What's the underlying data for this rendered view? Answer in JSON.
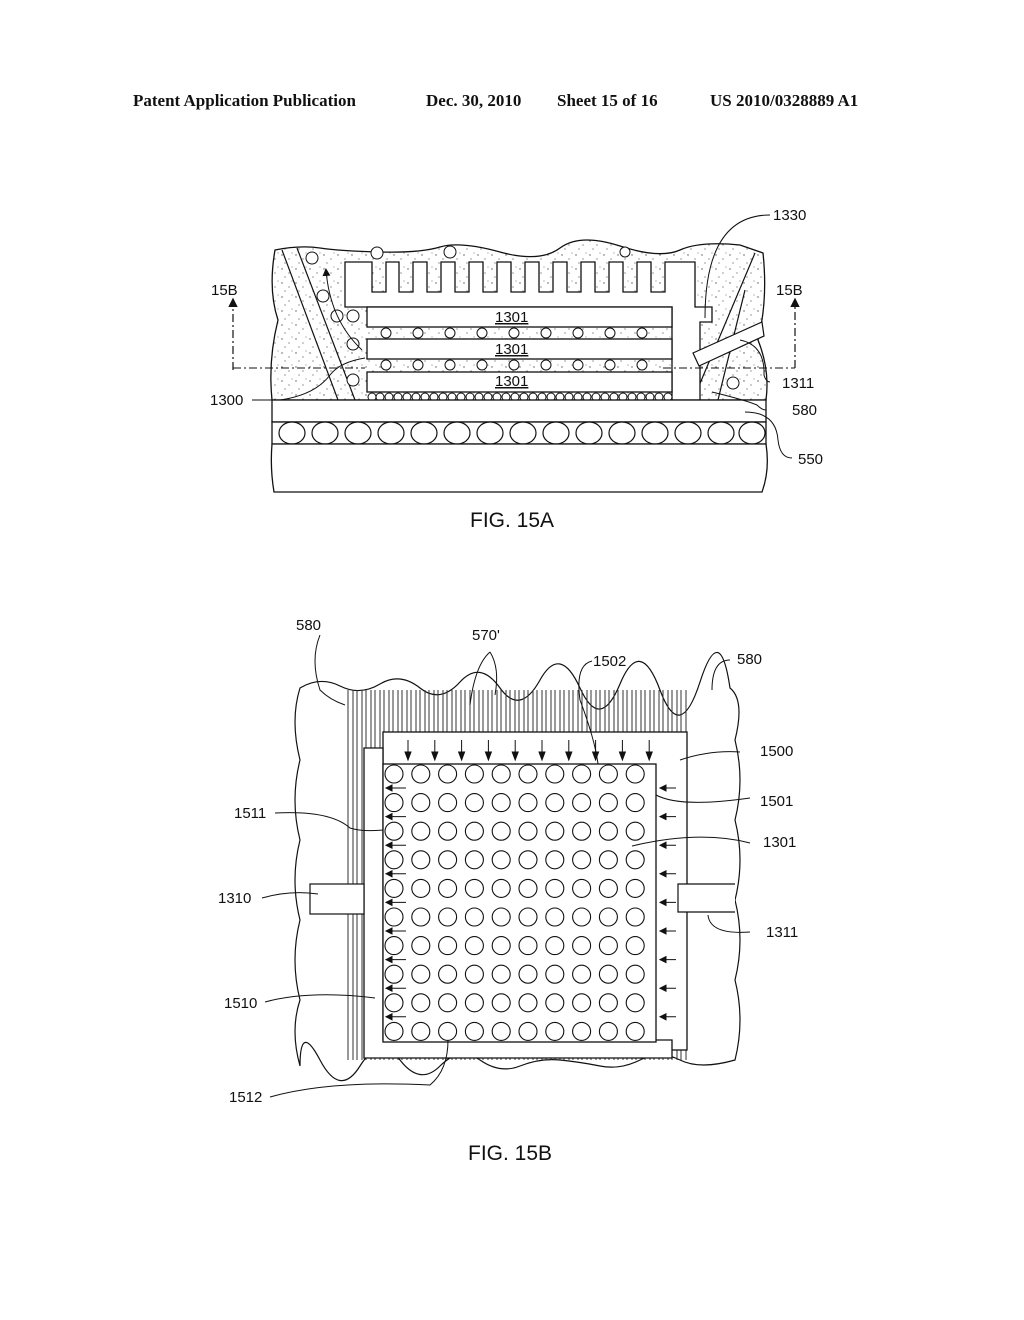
{
  "header": {
    "publication": "Patent Application Publication",
    "date": "Dec. 30, 2010",
    "sheet": "Sheet 15 of 16",
    "number": "US 2010/0328889 A1"
  },
  "fig15a": {
    "caption": "FIG. 15A",
    "section_left": "15B",
    "section_right": "15B",
    "die_labels": [
      "1301",
      "1301",
      "1301"
    ],
    "refs": {
      "r1330": "1330",
      "r1311": "1311",
      "r1300": "1300",
      "r580": "580",
      "r550": "550"
    }
  },
  "fig15b": {
    "caption": "FIG. 15B",
    "refs": {
      "r580_left": "580",
      "r570": "570'",
      "r1502": "1502",
      "r580_right": "580",
      "r1500": "1500",
      "r1501": "1501",
      "r1301": "1301",
      "r1511": "1511",
      "r1310": "1310",
      "r1311": "1311",
      "r1510": "1510",
      "r1512": "1512"
    },
    "grid": {
      "rows": 10,
      "cols": 10
    }
  }
}
